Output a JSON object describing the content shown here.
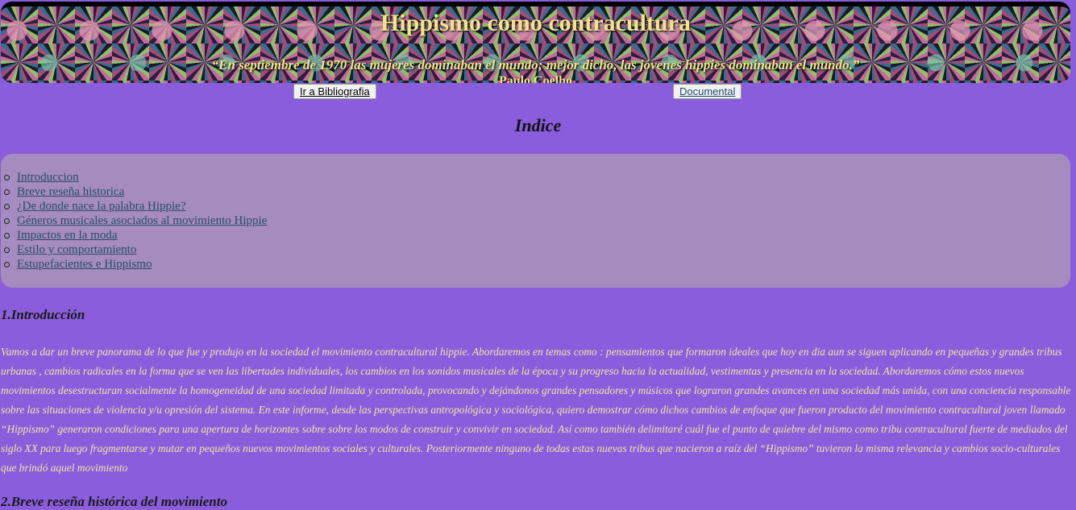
{
  "banner": {
    "title": "Hippismo como contracultura",
    "quote": "“En septiembre de 1970 las mujeres dominaban el mundo; mejor dicho, las jóvenes hippies dominaban el mundo.”",
    "author": "Paulo Coelho"
  },
  "nav": {
    "bibliografia": "Ir a Bibliografia",
    "documental": "Documental"
  },
  "indice": {
    "title": "Indice",
    "items": [
      "Introduccion",
      "Breve reseña historica",
      "¿De donde nace la palabra Hippie?",
      "Géneros musicales asociados al movimiento Hippie",
      "Impactos en la moda",
      "Estilo y comportamiento",
      "Estupefacientes e Hippismo"
    ]
  },
  "sections": {
    "intro_heading": "1.Introducción",
    "intro_text": "Vamos a dar un breve panorama de lo que fue y produjo en la sociedad el movimiento contracultural hippie. Abordaremos en temas como : pensamientos que formaron ideales que hoy en dia aun se siguen aplicando en pequeñas y grandes tribus urbanas , cambios radicales en la forma que se ven las libertades individuales, los cambios en los sonidos musicales de la época y su progreso hacia la actualidad, vestimentas y presencia en la sociedad. Abordaremos cómo estos nuevos movimientos desestructuran socialmente la homogeneidad de una sociedad limitada y controlada, provocando y dejándonos grandes pensadores y músicos que lograron grandes avances en una sociedad más unida, con una conciencia responsable sobre las situaciones de violencia y/u opresión del sistema. En este informe, desde las perspectivas antropológica y sociológica, quiero demostrar cómo dichos cambios de enfoque que fueron producto del movimiento contracultural joven llamado “Hippismo” generaron condiciones para una apertura de horizontes sobre sobre los modos de construir y convivir en sociedad. Así como también delimitaré cuál fue el punto de quiebre del mismo como tribu contracultural fuerte de mediados del siglo XX para luego fragmentarse y mutar en pequeños nuevos movimientos sociales y culturales. Posteriormente ninguno de todas estas nuevas tribus que nacieron a raíz del “Hippismo” tuvieron la misma relevancia y cambios socio-culturales que brindó aquel movimiento",
    "history_heading": "2.Breve reseña histórica del movimiento"
  }
}
